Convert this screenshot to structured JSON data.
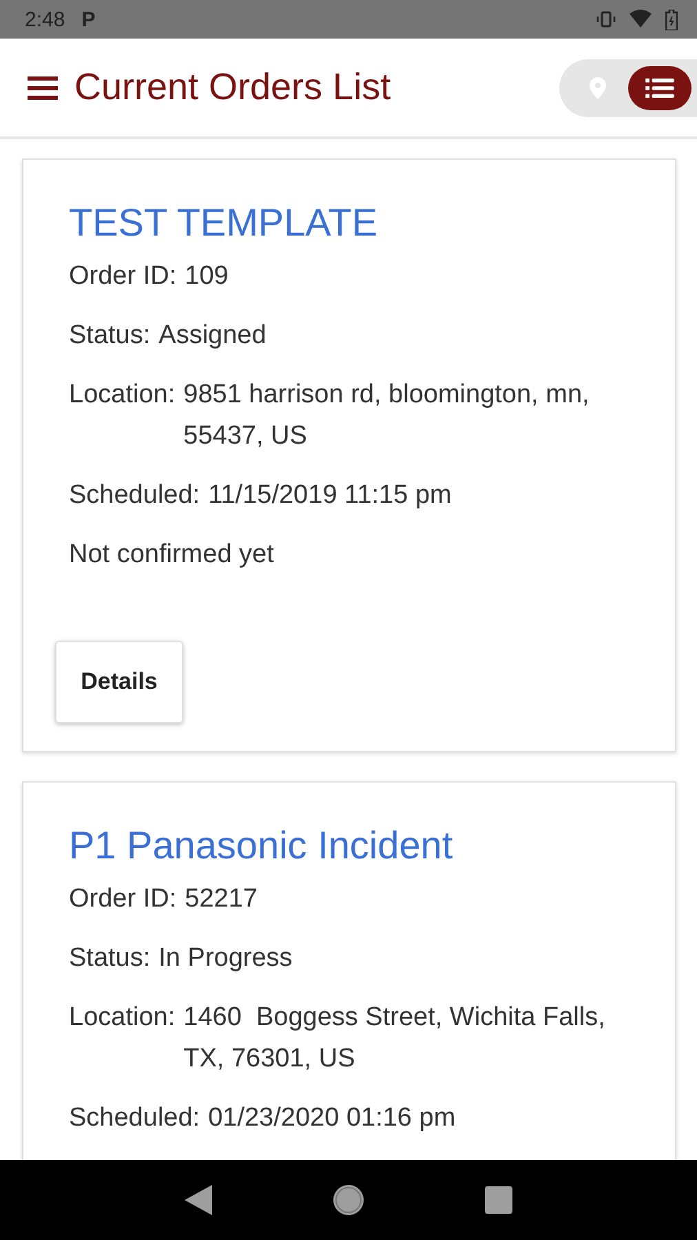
{
  "status_bar": {
    "time": "2:48",
    "app_glyph": "P"
  },
  "app_bar": {
    "title": "Current Orders List",
    "view_toggle": [
      {
        "kind": "map",
        "selected": false
      },
      {
        "kind": "list",
        "selected": true
      }
    ]
  },
  "orders": [
    {
      "title": "TEST TEMPLATE",
      "fields": [
        {
          "label": "Order ID:",
          "value": "109"
        },
        {
          "label": "Status:",
          "value": "Assigned"
        },
        {
          "label": "Location:",
          "value": "9851 harrison rd, bloomington, mn, 55437, US"
        },
        {
          "label": "Scheduled:",
          "value": "11/15/2019 11:15 pm"
        }
      ],
      "note": "Not confirmed yet",
      "button": "Details"
    },
    {
      "title": "P1 Panasonic Incident",
      "fields": [
        {
          "label": "Order ID:",
          "value": "52217"
        },
        {
          "label": "Status:",
          "value": "In Progress"
        },
        {
          "label": "Location:",
          "value": "1460  Boggess Street, Wichita Falls, TX, 76301, US"
        },
        {
          "label": "Scheduled:",
          "value": "01/23/2020 01:16 pm"
        }
      ]
    }
  ]
}
